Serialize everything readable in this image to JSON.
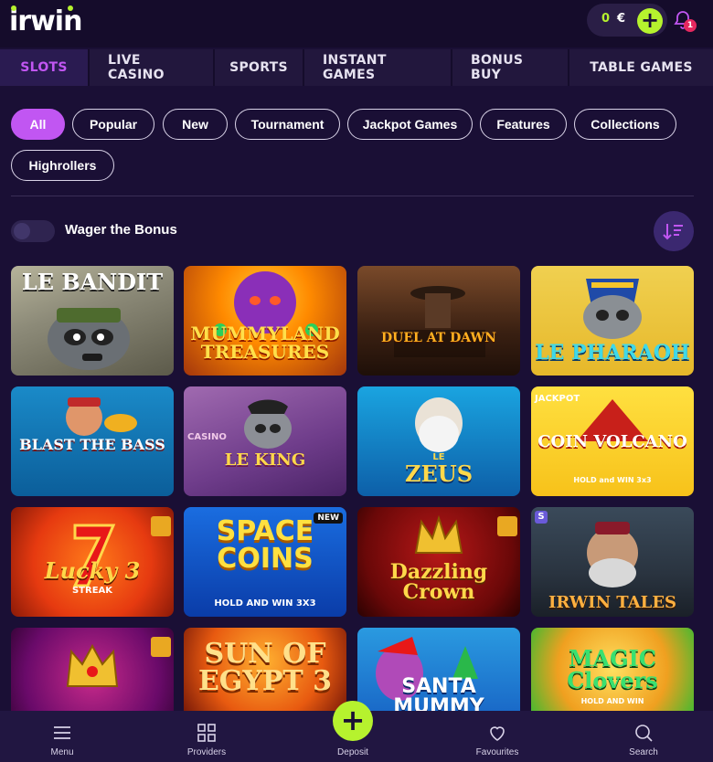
{
  "brand": {
    "logo_text": "irwin",
    "accent": "#b6f22e",
    "purple": "#c156f2"
  },
  "header": {
    "balance_amount": "0",
    "balance_currency": "€",
    "notifications_count": "1"
  },
  "tabs": [
    "SLOTS",
    "LIVE CASINO",
    "SPORTS",
    "INSTANT GAMES",
    "BONUS BUY",
    "TABLE GAMES"
  ],
  "active_tab": "SLOTS",
  "filters": [
    "All",
    "Popular",
    "New",
    "Tournament",
    "Jackpot Games",
    "Features",
    "Collections",
    "Highrollers"
  ],
  "active_filter": "All",
  "wager": {
    "label": "Wager the Bonus",
    "enabled": false
  },
  "games": [
    {
      "title": "LE BANDIT"
    },
    {
      "title": "MUMMYLAND TREASURES"
    },
    {
      "title": "DUEL AT DAWN"
    },
    {
      "title": "LE PHARAOH"
    },
    {
      "title": "BLAST THE BASS"
    },
    {
      "title": "LE KING",
      "subtitle": "CASINO"
    },
    {
      "title": "ZEUS",
      "subtitle": "LE"
    },
    {
      "title": "COIN VOLCANO",
      "subtitle": "HOLD and WIN 3x3",
      "badge": "JACKPOT"
    },
    {
      "title": "Lucky 3",
      "subtitle": "STREAK"
    },
    {
      "title": "SPACE COINS",
      "subtitle": "HOLD AND WIN 3X3",
      "badge": "NEW"
    },
    {
      "title": "Dazzling Crown"
    },
    {
      "title": "IRWIN TALES",
      "badge": "S"
    },
    {
      "title": ""
    },
    {
      "title": "SUN OF EGYPT 3"
    },
    {
      "title": "SANTA MUMMY"
    },
    {
      "title": "MAGIC Clovers",
      "subtitle": "HOLD AND WIN"
    }
  ],
  "bottom_nav": {
    "menu": "Menu",
    "providers": "Providers",
    "deposit": "Deposit",
    "favourites": "Favourites",
    "search": "Search"
  }
}
